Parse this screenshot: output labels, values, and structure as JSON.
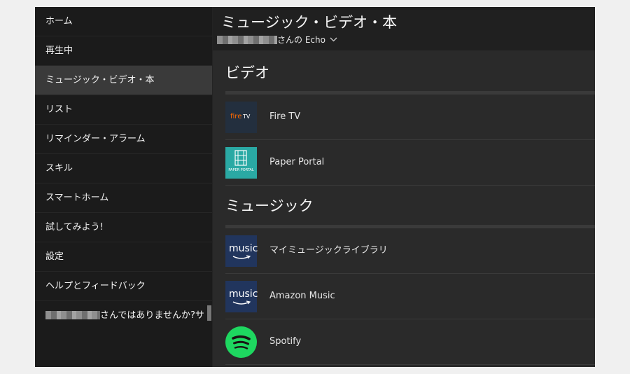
{
  "sidebar": {
    "items": [
      {
        "label": "ホーム"
      },
      {
        "label": "再生中"
      },
      {
        "label": "ミュージック・ビデオ・本",
        "active": true
      },
      {
        "label": "リスト"
      },
      {
        "label": "リマインダー・アラーム"
      },
      {
        "label": "スキル"
      },
      {
        "label": "スマートホーム"
      },
      {
        "label": "試してみよう!"
      },
      {
        "label": "設定"
      },
      {
        "label": "ヘルプとフィードバック"
      }
    ],
    "user_prompt": "さんではありませんか?サ"
  },
  "header": {
    "title": "ミュージック・ビデオ・本",
    "device_suffix": "さんの Echo"
  },
  "sections": {
    "video": {
      "title": "ビデオ",
      "items": [
        {
          "label": "Fire TV",
          "icon": "fire-tv-logo"
        },
        {
          "label": "Paper Portal",
          "icon": "paper-portal-logo"
        }
      ]
    },
    "music": {
      "title": "ミュージック",
      "items": [
        {
          "label": "マイミュージックライブラリ",
          "icon": "amazon-music-logo"
        },
        {
          "label": "Amazon Music",
          "icon": "amazon-music-logo"
        },
        {
          "label": "Spotify",
          "icon": "spotify-logo"
        }
      ]
    }
  },
  "logos": {
    "fire_tv": {
      "fire": "fire",
      "tv": "TV"
    },
    "paper_portal": "PAPER PORTAL",
    "music": "music"
  },
  "colors": {
    "sidebar_bg": "#1b1b1b",
    "active_bg": "#3a3a3a",
    "main_bg": "#2a2a2a",
    "spotify_green": "#1ed760",
    "amazon_music_blue": "#21355d",
    "paper_portal_teal": "#2aa9a4"
  }
}
